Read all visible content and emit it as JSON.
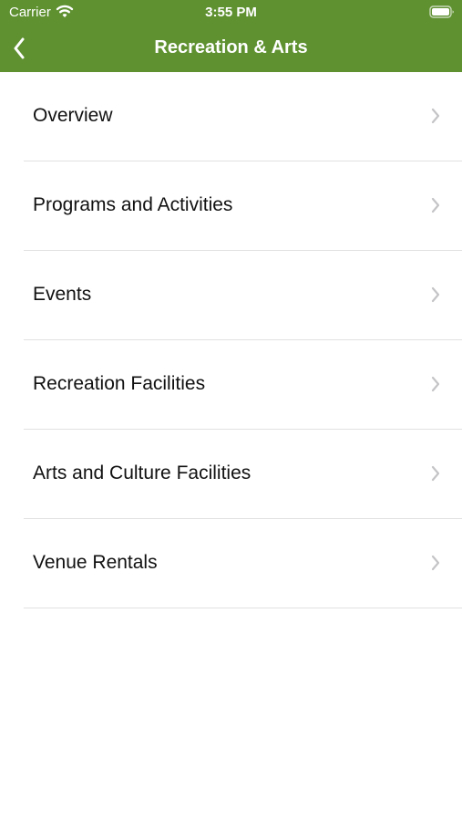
{
  "status_bar": {
    "carrier": "Carrier",
    "time": "3:55 PM"
  },
  "navbar": {
    "title": "Recreation & Arts",
    "back_icon": "chevron-left-icon"
  },
  "menu": {
    "items": [
      {
        "label": "Overview"
      },
      {
        "label": "Programs and Activities"
      },
      {
        "label": "Events"
      },
      {
        "label": "Recreation Facilities"
      },
      {
        "label": "Arts and Culture Facilities"
      },
      {
        "label": "Venue Rentals"
      }
    ],
    "disclosure_icon": "chevron-right-icon"
  },
  "colors": {
    "header_background": "#5f9131",
    "header_text": "#ffffff",
    "list_text": "#111111",
    "separator": "#e1e1e1",
    "chevron": "#c4c4c7"
  }
}
